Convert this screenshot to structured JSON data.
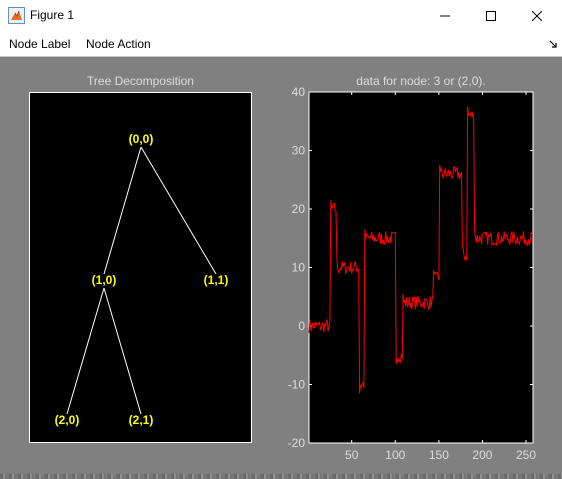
{
  "window": {
    "title": "Figure 1"
  },
  "menu": {
    "items": [
      "Node Label",
      "Node Action"
    ]
  },
  "colors": {
    "figure_bg": "#808080",
    "axes_bg": "#000000",
    "node_label": "#ffff00",
    "edge": "#ffffff",
    "signal": "#ff0000"
  },
  "tree": {
    "title": "Tree Decomposition",
    "nodes": [
      {
        "label": "(0,0)"
      },
      {
        "label": "(1,0)"
      },
      {
        "label": "(1,1)"
      },
      {
        "label": "(2,0)"
      },
      {
        "label": "(2,1)"
      }
    ],
    "edges": [
      [
        0,
        1
      ],
      [
        0,
        2
      ],
      [
        1,
        3
      ],
      [
        1,
        4
      ]
    ]
  },
  "plot": {
    "title": "data for node: 3 or (2,0).",
    "xticks": [
      "50",
      "100",
      "150",
      "200",
      "250"
    ],
    "yticks": [
      "40",
      "30",
      "20",
      "10",
      "0",
      "-10",
      "-20"
    ]
  },
  "chart_data": {
    "type": "line",
    "title": "data for node: 3 or (2,0).",
    "xlim": [
      1,
      258
    ],
    "ylim": [
      -20,
      40
    ],
    "grid": false,
    "series": [
      {
        "color": "#ff0000",
        "segments": [
          {
            "x_start": 1,
            "x_end": 25,
            "level": 0
          },
          {
            "x_start": 26,
            "x_end": 32,
            "level": 20
          },
          {
            "x_start": 33,
            "x_end": 58,
            "level": 10
          },
          {
            "x_start": 59,
            "x_end": 64,
            "level": -10
          },
          {
            "x_start": 65,
            "x_end": 100,
            "level": 15
          },
          {
            "x_start": 101,
            "x_end": 108,
            "level": -5
          },
          {
            "x_start": 109,
            "x_end": 143,
            "level": 4
          },
          {
            "x_start": 144,
            "x_end": 150,
            "level": 8
          },
          {
            "x_start": 151,
            "x_end": 176,
            "level": 26
          },
          {
            "x_start": 177,
            "x_end": 182,
            "level": 12
          },
          {
            "x_start": 183,
            "x_end": 190,
            "level": 36
          },
          {
            "x_start": 191,
            "x_end": 258,
            "level": 15
          }
        ]
      }
    ]
  }
}
